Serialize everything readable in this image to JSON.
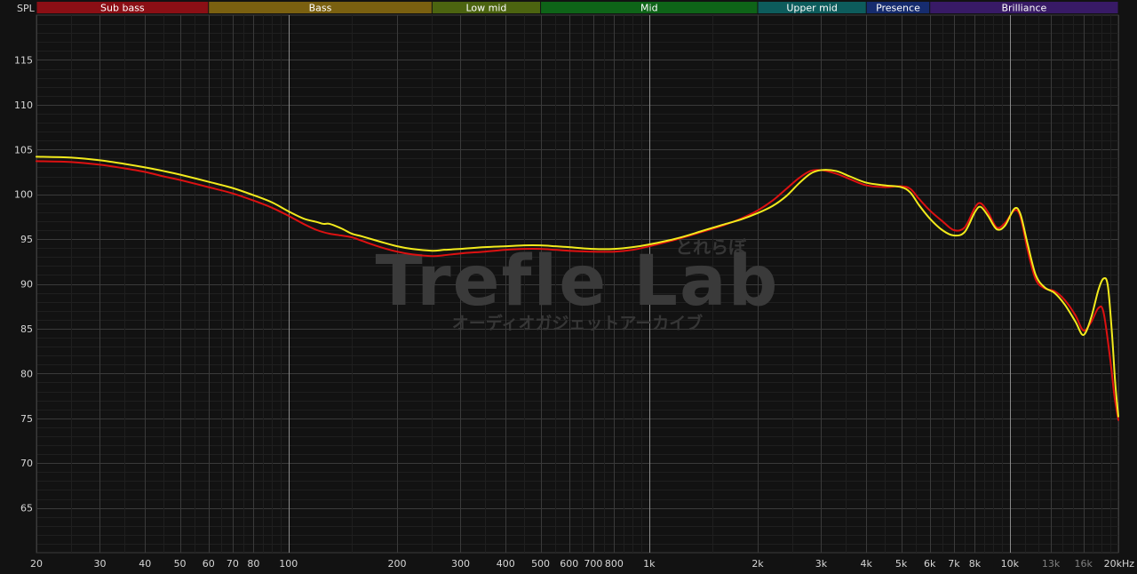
{
  "chart_data": {
    "type": "line",
    "title": "",
    "ylabel": "SPL",
    "xlabel": "",
    "x_scale": "log",
    "xlim": [
      20,
      20000
    ],
    "ylim": [
      60,
      120
    ],
    "grid": true,
    "y_ticks": [
      65,
      70,
      75,
      80,
      85,
      90,
      95,
      100,
      105,
      110,
      115
    ],
    "x_ticks": [
      {
        "value": 20,
        "label": "20"
      },
      {
        "value": 30,
        "label": "30"
      },
      {
        "value": 40,
        "label": "40"
      },
      {
        "value": 50,
        "label": "50"
      },
      {
        "value": 60,
        "label": "60"
      },
      {
        "value": 70,
        "label": "70"
      },
      {
        "value": 80,
        "label": "80"
      },
      {
        "value": 100,
        "label": "100"
      },
      {
        "value": 200,
        "label": "200"
      },
      {
        "value": 300,
        "label": "300"
      },
      {
        "value": 400,
        "label": "400"
      },
      {
        "value": 500,
        "label": "500"
      },
      {
        "value": 600,
        "label": "600"
      },
      {
        "value": 700,
        "label": "700"
      },
      {
        "value": 800,
        "label": "800"
      },
      {
        "value": 1000,
        "label": "1k"
      },
      {
        "value": 2000,
        "label": "2k"
      },
      {
        "value": 3000,
        "label": "3k"
      },
      {
        "value": 4000,
        "label": "4k"
      },
      {
        "value": 5000,
        "label": "5k"
      },
      {
        "value": 6000,
        "label": "6k"
      },
      {
        "value": 7000,
        "label": "7k"
      },
      {
        "value": 8000,
        "label": "8k"
      },
      {
        "value": 10000,
        "label": "10k"
      },
      {
        "value": 13000,
        "label": "13k",
        "dim": true
      },
      {
        "value": 16000,
        "label": "16k",
        "dim": true
      },
      {
        "value": 20000,
        "label": "20kHz"
      }
    ],
    "bands": [
      {
        "label": "Sub bass",
        "from": 20,
        "to": 60,
        "color": "#8b0f15"
      },
      {
        "label": "Bass",
        "from": 60,
        "to": 250,
        "color": "#7a6010"
      },
      {
        "label": "Low mid",
        "from": 250,
        "to": 500,
        "color": "#4c6410"
      },
      {
        "label": "Mid",
        "from": 500,
        "to": 2000,
        "color": "#0e6418"
      },
      {
        "label": "Upper mid",
        "from": 2000,
        "to": 4000,
        "color": "#0d5c5c"
      },
      {
        "label": "Presence",
        "from": 4000,
        "to": 6000,
        "color": "#162c6e"
      },
      {
        "label": "Brilliance",
        "from": 6000,
        "to": 20000,
        "color": "#381a66"
      }
    ],
    "watermark": {
      "main": "Trefle Lab",
      "sub": "オーディオガジェットアーカイブ",
      "top": "とれらぼ"
    },
    "series": [
      {
        "color": "#dd1111",
        "points": [
          [
            20,
            103.7
          ],
          [
            25,
            103.6
          ],
          [
            30,
            103.3
          ],
          [
            35,
            102.9
          ],
          [
            40,
            102.5
          ],
          [
            45,
            102.0
          ],
          [
            50,
            101.6
          ],
          [
            60,
            100.8
          ],
          [
            70,
            100.1
          ],
          [
            80,
            99.3
          ],
          [
            90,
            98.5
          ],
          [
            100,
            97.6
          ],
          [
            110,
            96.7
          ],
          [
            120,
            96.0
          ],
          [
            130,
            95.6
          ],
          [
            140,
            95.4
          ],
          [
            150,
            95.2
          ],
          [
            160,
            94.8
          ],
          [
            180,
            94.1
          ],
          [
            200,
            93.6
          ],
          [
            220,
            93.3
          ],
          [
            250,
            93.1
          ],
          [
            270,
            93.2
          ],
          [
            300,
            93.4
          ],
          [
            350,
            93.6
          ],
          [
            400,
            93.8
          ],
          [
            450,
            93.9
          ],
          [
            500,
            93.9
          ],
          [
            550,
            93.8
          ],
          [
            600,
            93.7
          ],
          [
            700,
            93.6
          ],
          [
            800,
            93.6
          ],
          [
            900,
            93.8
          ],
          [
            1000,
            94.2
          ],
          [
            1200,
            95.0
          ],
          [
            1400,
            95.8
          ],
          [
            1600,
            96.5
          ],
          [
            1800,
            97.3
          ],
          [
            2000,
            98.2
          ],
          [
            2200,
            99.3
          ],
          [
            2400,
            100.6
          ],
          [
            2600,
            101.8
          ],
          [
            2800,
            102.6
          ],
          [
            3000,
            102.7
          ],
          [
            3300,
            102.3
          ],
          [
            3600,
            101.7
          ],
          [
            4000,
            101.0
          ],
          [
            4500,
            100.8
          ],
          [
            5000,
            100.9
          ],
          [
            5300,
            100.6
          ],
          [
            5600,
            99.5
          ],
          [
            6000,
            98.2
          ],
          [
            6500,
            97.0
          ],
          [
            7000,
            96.0
          ],
          [
            7500,
            96.3
          ],
          [
            8000,
            98.5
          ],
          [
            8300,
            99.0
          ],
          [
            8700,
            98.0
          ],
          [
            9200,
            96.3
          ],
          [
            9700,
            96.8
          ],
          [
            10300,
            98.2
          ],
          [
            10700,
            97.5
          ],
          [
            11200,
            93.8
          ],
          [
            11800,
            90.5
          ],
          [
            12500,
            89.5
          ],
          [
            13300,
            89.2
          ],
          [
            14200,
            88.2
          ],
          [
            15200,
            86.5
          ],
          [
            16000,
            84.8
          ],
          [
            16800,
            85.7
          ],
          [
            17600,
            87.3
          ],
          [
            18200,
            86.8
          ],
          [
            19000,
            81.5
          ],
          [
            19500,
            77.5
          ],
          [
            20000,
            74.8
          ]
        ]
      },
      {
        "color": "#f2ea1c",
        "points": [
          [
            20,
            104.2
          ],
          [
            25,
            104.1
          ],
          [
            30,
            103.8
          ],
          [
            35,
            103.4
          ],
          [
            40,
            103.0
          ],
          [
            45,
            102.6
          ],
          [
            50,
            102.2
          ],
          [
            60,
            101.4
          ],
          [
            70,
            100.7
          ],
          [
            80,
            99.9
          ],
          [
            90,
            99.1
          ],
          [
            100,
            98.1
          ],
          [
            110,
            97.3
          ],
          [
            120,
            96.9
          ],
          [
            125,
            96.7
          ],
          [
            130,
            96.7
          ],
          [
            140,
            96.2
          ],
          [
            150,
            95.6
          ],
          [
            160,
            95.3
          ],
          [
            180,
            94.7
          ],
          [
            200,
            94.2
          ],
          [
            220,
            93.9
          ],
          [
            250,
            93.7
          ],
          [
            270,
            93.8
          ],
          [
            300,
            93.9
          ],
          [
            350,
            94.1
          ],
          [
            400,
            94.2
          ],
          [
            450,
            94.3
          ],
          [
            500,
            94.3
          ],
          [
            550,
            94.2
          ],
          [
            600,
            94.1
          ],
          [
            700,
            93.9
          ],
          [
            800,
            93.9
          ],
          [
            900,
            94.1
          ],
          [
            1000,
            94.4
          ],
          [
            1200,
            95.1
          ],
          [
            1400,
            95.9
          ],
          [
            1600,
            96.6
          ],
          [
            1800,
            97.2
          ],
          [
            2000,
            97.9
          ],
          [
            2200,
            98.7
          ],
          [
            2400,
            99.8
          ],
          [
            2600,
            101.2
          ],
          [
            2800,
            102.3
          ],
          [
            3000,
            102.7
          ],
          [
            3300,
            102.6
          ],
          [
            3600,
            102.0
          ],
          [
            4000,
            101.3
          ],
          [
            4500,
            101.0
          ],
          [
            5000,
            100.8
          ],
          [
            5300,
            100.2
          ],
          [
            5600,
            98.8
          ],
          [
            6000,
            97.3
          ],
          [
            6500,
            96.0
          ],
          [
            7000,
            95.4
          ],
          [
            7500,
            95.8
          ],
          [
            8000,
            98.0
          ],
          [
            8300,
            98.6
          ],
          [
            8700,
            97.6
          ],
          [
            9200,
            96.1
          ],
          [
            9700,
            96.5
          ],
          [
            10300,
            98.4
          ],
          [
            10700,
            97.8
          ],
          [
            11200,
            94.5
          ],
          [
            11800,
            91.0
          ],
          [
            12500,
            89.6
          ],
          [
            13300,
            89.0
          ],
          [
            14200,
            87.7
          ],
          [
            15200,
            85.8
          ],
          [
            16000,
            84.3
          ],
          [
            16800,
            86.2
          ],
          [
            17600,
            89.3
          ],
          [
            18200,
            90.6
          ],
          [
            18700,
            89.8
          ],
          [
            19200,
            84.5
          ],
          [
            19600,
            79.0
          ],
          [
            20000,
            75.2
          ]
        ]
      }
    ]
  }
}
